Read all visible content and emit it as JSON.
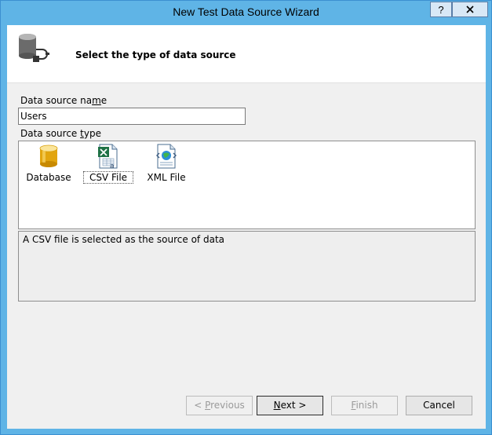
{
  "window": {
    "title": "New Test Data Source Wizard",
    "help_label": "?",
    "close_label": "X"
  },
  "header": {
    "instruction": "Select the type of data source"
  },
  "form": {
    "name_label_pre": "Data source na",
    "name_label_access": "m",
    "name_label_post": "e",
    "name_value": "Users",
    "type_label_pre": "Data source ",
    "type_label_access": "t",
    "type_label_post": "ype"
  },
  "types": [
    {
      "label": "Database",
      "icon": "database-icon"
    },
    {
      "label": "CSV File",
      "icon": "csv-file-icon"
    },
    {
      "label": "XML File",
      "icon": "xml-file-icon"
    }
  ],
  "selected_type": "CSV File",
  "description": "A CSV file is selected as the source of data",
  "buttons": {
    "previous_pre": "< ",
    "previous_access": "P",
    "previous_post": "revious",
    "next_access": "N",
    "next_post": "ext >",
    "finish_access": "F",
    "finish_post": "inish",
    "cancel": "Cancel"
  }
}
